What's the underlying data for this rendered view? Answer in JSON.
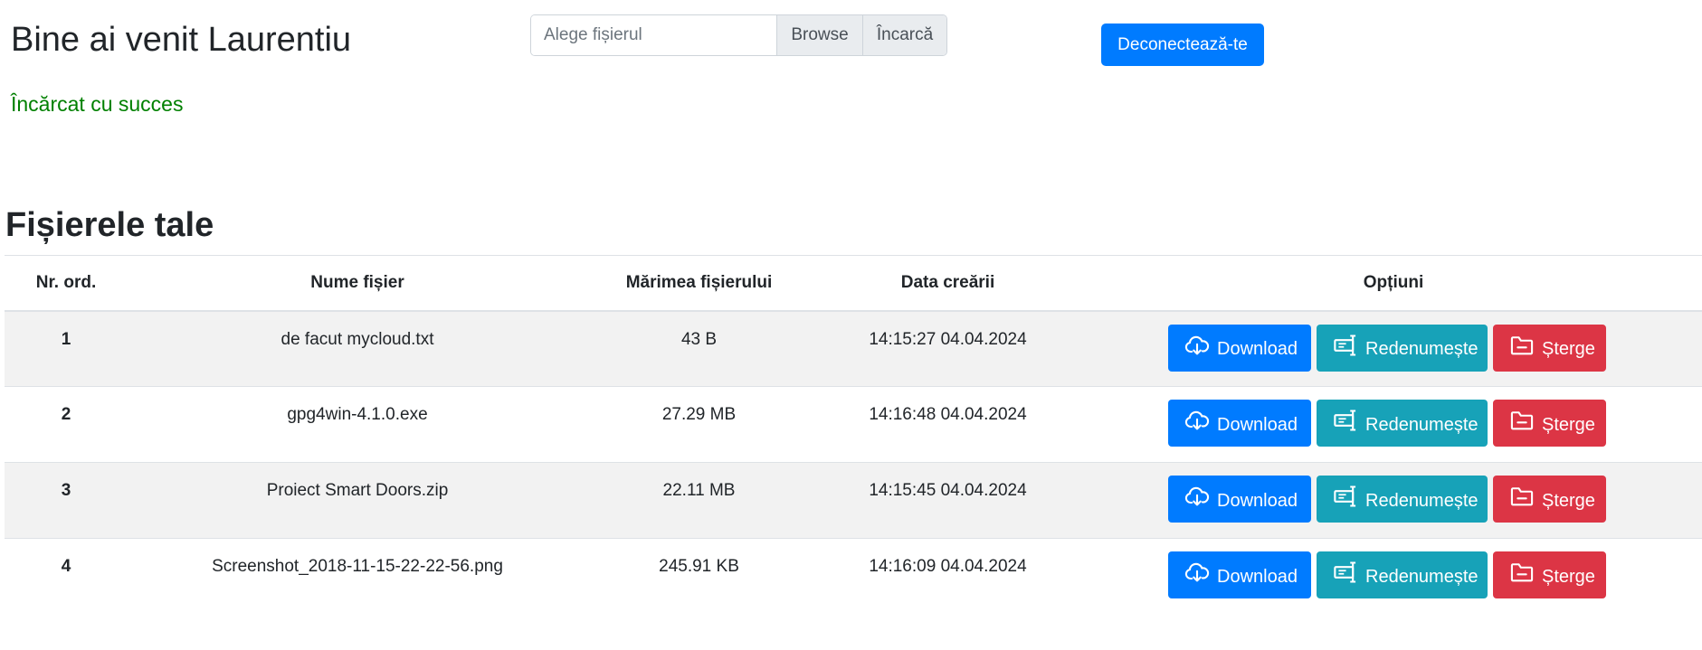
{
  "header": {
    "welcome": "Bine ai venit Laurentiu",
    "file_placeholder": "Alege fișierul",
    "browse_label": "Browse",
    "upload_label": "Încarcă",
    "logout_label": "Deconectează-te"
  },
  "status": {
    "message": "Încărcat cu succes",
    "color": "#008000"
  },
  "files_section": {
    "title": "Fișierele tale",
    "columns": {
      "nr": "Nr. ord.",
      "name": "Nume fișier",
      "size": "Mărimea fișierului",
      "date": "Data creării",
      "options": "Opțiuni"
    },
    "rows": [
      {
        "nr": "1",
        "name": "de facut mycloud.txt",
        "size": "43 B",
        "date": "14:15:27 04.04.2024"
      },
      {
        "nr": "2",
        "name": "gpg4win-4.1.0.exe",
        "size": "27.29 MB",
        "date": "14:16:48 04.04.2024"
      },
      {
        "nr": "3",
        "name": "Proiect Smart Doors.zip",
        "size": "22.11 MB",
        "date": "14:15:45 04.04.2024"
      },
      {
        "nr": "4",
        "name": "Screenshot_2018-11-15-22-22-56.png",
        "size": "245.91 KB",
        "date": "14:16:09 04.04.2024"
      }
    ],
    "actions": {
      "download": {
        "label": "Download",
        "icon": "cloud-download-icon",
        "color": "#007bff"
      },
      "rename": {
        "label": "Redenumește",
        "icon": "rename-icon",
        "color": "#17a2b8"
      },
      "delete": {
        "label": "Șterge",
        "icon": "folder-minus-icon",
        "color": "#dc3545"
      }
    }
  }
}
